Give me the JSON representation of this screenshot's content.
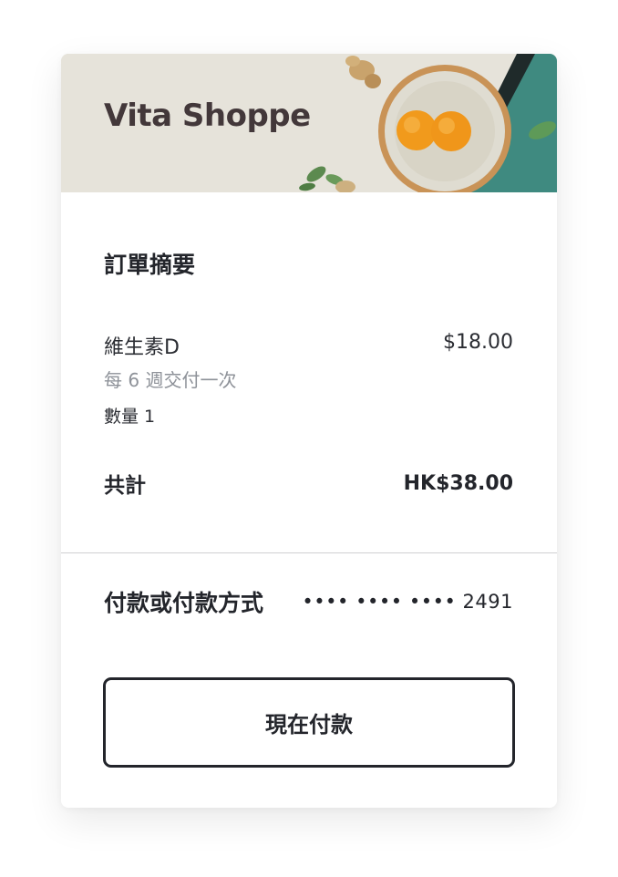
{
  "brand": {
    "name": "Vita Shoppe"
  },
  "summary": {
    "title": "訂單摘要",
    "item": {
      "name": "維生素D",
      "price": "$18.00",
      "frequency": "每 6 週交付一次",
      "quantity": "數量 1"
    },
    "total_label": "共計",
    "total_value": "HK$38.00"
  },
  "payment": {
    "label": "付款或付款方式",
    "card_masked": "•••• •••• •••• 2491"
  },
  "actions": {
    "pay_now": "現在付款"
  },
  "colors": {
    "brand_text": "#43383a",
    "banner_bg": "#e6e3da",
    "teal": "#3f8a80",
    "orange": "#f19a1c",
    "text_primary": "#23252b",
    "text_muted": "#8e9299"
  }
}
